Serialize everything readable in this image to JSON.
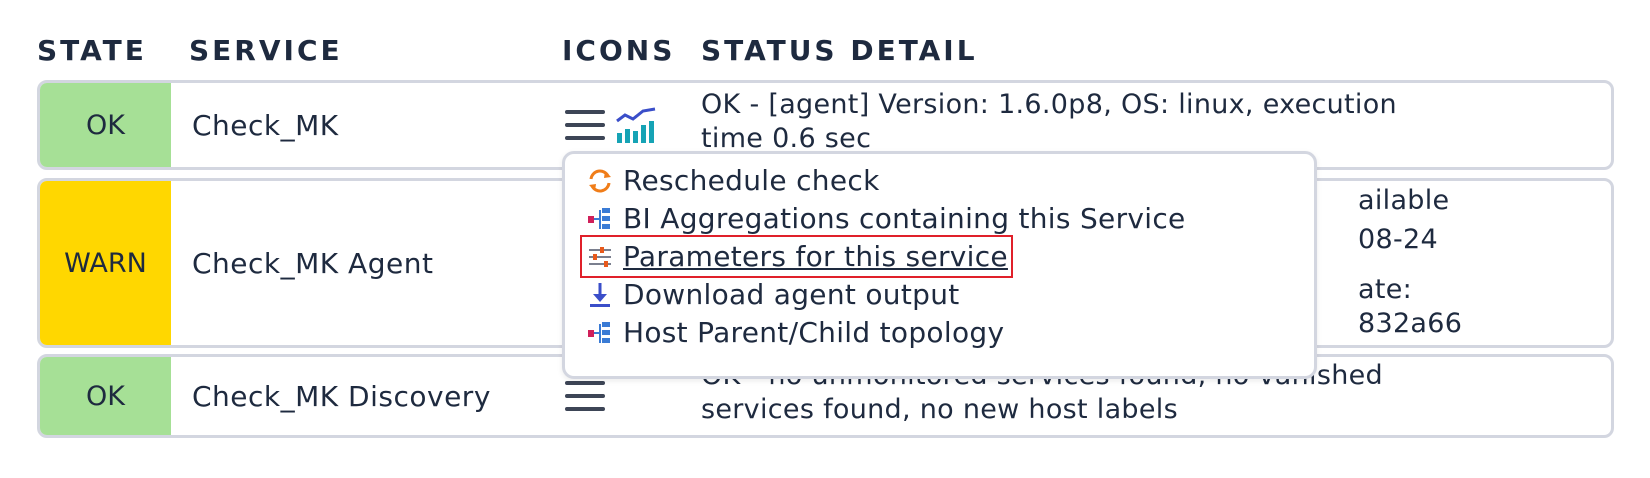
{
  "table": {
    "headers": {
      "state": "STATE",
      "service": "SERVICE",
      "icons": "ICONS",
      "status_detail": "STATUS DETAIL"
    },
    "rows": [
      {
        "state": "OK",
        "service": "Check_MK",
        "detail": "OK - [agent] Version: 1.6.0p8, OS: linux, execution\ntime 0.6 sec"
      },
      {
        "state": "WARN",
        "service": "Check_MK Agent",
        "detail_visible": [
          "ailable",
          "08-24",
          "ate:",
          "832a66"
        ]
      },
      {
        "state": "OK",
        "service": "Check_MK Discovery",
        "detail": "OK - no unmonitored services found, no vanished\nservices found, no new host labels"
      }
    ]
  },
  "colors": {
    "ok": "#a6e096",
    "warn": "#ffd700",
    "text": "#1e2a3f",
    "highlight": "#e0202a"
  },
  "popup_menu": {
    "items": [
      {
        "label": "Reschedule check",
        "icon": "reschedule-icon"
      },
      {
        "label": "BI Aggregations containing this Service",
        "icon": "bi-aggregation-icon"
      },
      {
        "label": "Parameters for this service",
        "icon": "parameters-icon",
        "highlighted": true
      },
      {
        "label": "Download agent output",
        "icon": "download-icon"
      },
      {
        "label": "Host Parent/Child topology",
        "icon": "topology-icon"
      }
    ]
  }
}
